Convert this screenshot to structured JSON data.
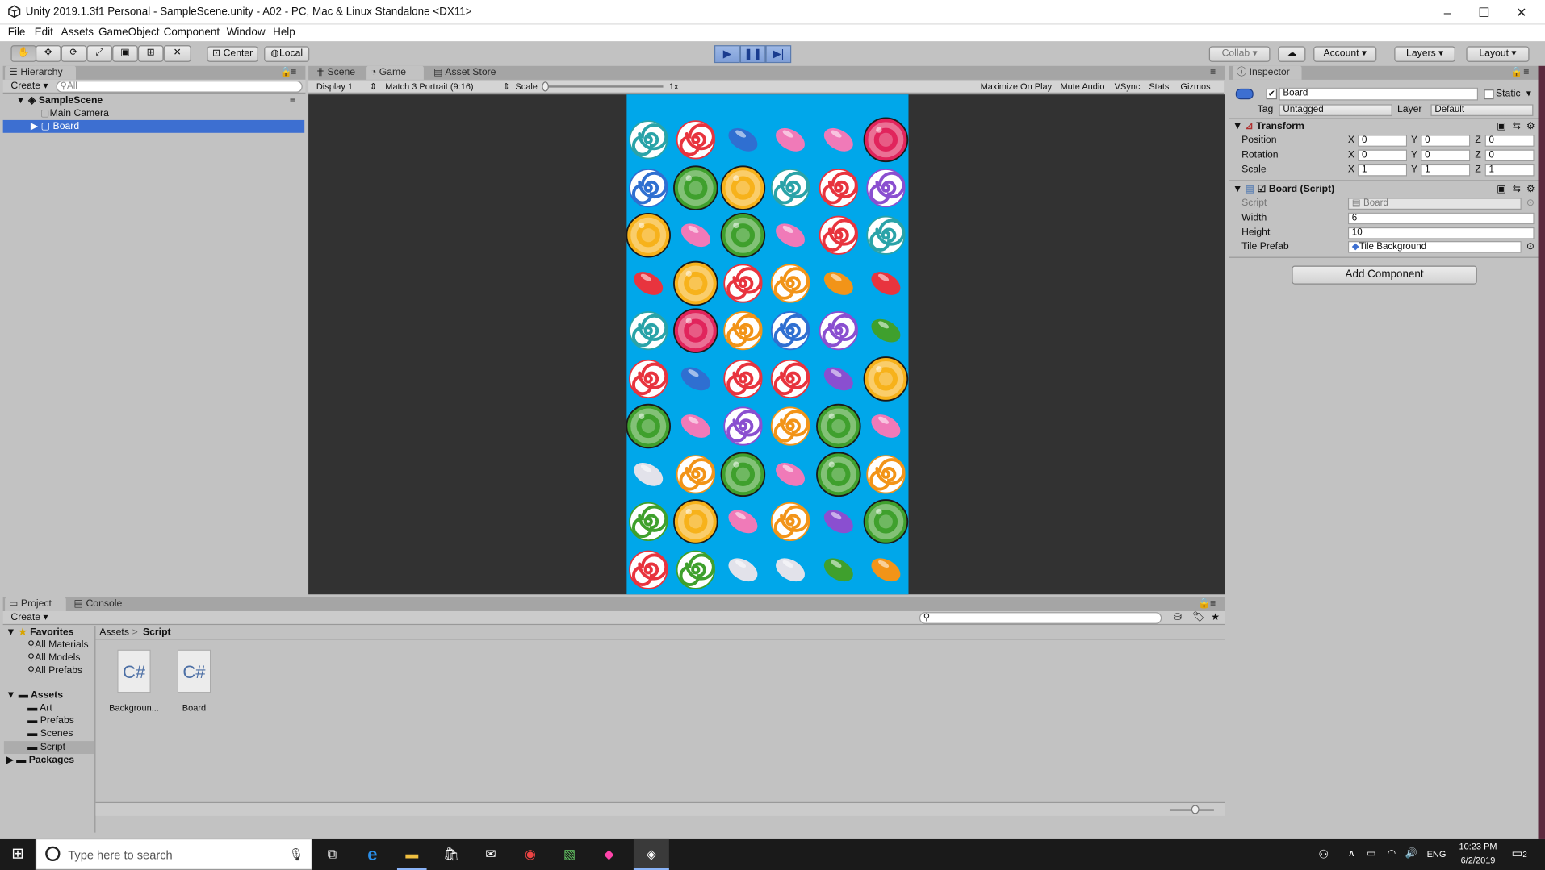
{
  "window": {
    "title": "Unity 2019.1.3f1 Personal - SampleScene.unity - A02 - PC, Mac & Linux Standalone <DX11>",
    "min_glyph": "–",
    "max_glyph": "☐",
    "close_glyph": "✕"
  },
  "menu": [
    "File",
    "Edit",
    "Assets",
    "GameObject",
    "Component",
    "Window",
    "Help"
  ],
  "toolbar": {
    "center": "Center",
    "local": "Local",
    "collab": "Collab ▾",
    "account": "Account ▾",
    "layers": "Layers ▾",
    "layout": "Layout ▾"
  },
  "hierarchy": {
    "tab": "Hierarchy",
    "create": "Create ▾",
    "search_placeholder": "All",
    "scene": "SampleScene",
    "items": [
      "Main Camera",
      "Board"
    ]
  },
  "tabs": {
    "scene": "Scene",
    "game": "Game",
    "store": "Asset Store"
  },
  "gamebar": {
    "display": "Display 1",
    "aspect": "Match 3 Portrait (9:16)",
    "scale_label": "Scale",
    "scale_value": "1x",
    "maximize": "Maximize On Play",
    "mute": "Mute Audio",
    "vsync": "VSync",
    "stats": "Stats",
    "gizmos": "Gizmos"
  },
  "inspector": {
    "tab": "Inspector",
    "name": "Board",
    "static": "Static",
    "tag_label": "Tag",
    "tag_value": "Untagged",
    "layer_label": "Layer",
    "layer_value": "Default",
    "transform_title": "Transform",
    "position_label": "Position",
    "rotation_label": "Rotation",
    "scale_label": "Scale",
    "position": [
      "0",
      "0",
      "0"
    ],
    "rotation": [
      "0",
      "0",
      "0"
    ],
    "scale": [
      "1",
      "1",
      "1"
    ],
    "axis": [
      "X",
      "Y",
      "Z"
    ],
    "script_title": "Board (Script)",
    "script_label": "Script",
    "script_value": "Board",
    "width_label": "Width",
    "width_value": "6",
    "height_label": "Height",
    "height_value": "10",
    "tile_label": "Tile Prefab",
    "tile_value": "Tile Background",
    "add_component": "Add Component"
  },
  "project": {
    "tab_project": "Project",
    "tab_console": "Console",
    "create": "Create ▾",
    "favorites": "Favorites",
    "fav_items": [
      "All Materials",
      "All Models",
      "All Prefabs"
    ],
    "assets": "Assets",
    "asset_folders": [
      "Art",
      "Prefabs",
      "Scenes",
      "Script"
    ],
    "packages": "Packages",
    "breadcrumb_root": "Assets",
    "breadcrumb_sep": ">",
    "breadcrumb_current": "Script",
    "files": [
      {
        "icon": "C#",
        "label": "Backgroun..."
      },
      {
        "icon": "C#",
        "label": "Board"
      }
    ]
  },
  "taskbar": {
    "search_placeholder": "Type here to search",
    "lang": "ENG",
    "time": "10:23 PM",
    "date": "6/2/2019",
    "notif": "2"
  },
  "board_grid": [
    [
      "swirl-teal",
      "swirl-red",
      "bean-blue",
      "bean-pink",
      "bean-pink",
      "ball-magenta"
    ],
    [
      "swirl-blue",
      "ball-green",
      "ball-yellow",
      "swirl-teal",
      "swirl-red",
      "swirl-purple"
    ],
    [
      "ball-yellow",
      "bean-pink",
      "ball-green",
      "bean-pink",
      "swirl-red",
      "swirl-teal"
    ],
    [
      "bean-red",
      "ball-yellow",
      "swirl-red",
      "swirl-orange",
      "bean-orange",
      "bean-red"
    ],
    [
      "swirl-teal",
      "ball-magenta",
      "swirl-orange",
      "swirl-blue",
      "swirl-purple",
      "bean-green"
    ],
    [
      "swirl-red",
      "bean-blue",
      "swirl-red",
      "swirl-red",
      "bean-purple",
      "ball-yellow"
    ],
    [
      "ball-green",
      "bean-pink",
      "swirl-purple",
      "swirl-orange",
      "ball-green",
      "bean-pink"
    ],
    [
      "bean-white",
      "swirl-orange",
      "ball-green",
      "bean-pink",
      "ball-green",
      "swirl-orange"
    ],
    [
      "swirl-green",
      "ball-yellow",
      "bean-pink",
      "swirl-orange",
      "bean-purple",
      "ball-green"
    ],
    [
      "swirl-red",
      "swirl-green",
      "bean-white",
      "bean-white",
      "bean-green",
      "bean-orange"
    ]
  ],
  "colors": {
    "red": "#e8343e",
    "teal": "#2aa3a8",
    "blue": "#2f6fd1",
    "purple": "#8a4fd0",
    "orange": "#f29418",
    "green": "#3fa02d",
    "pink": "#f07ab8",
    "magenta": "#e1245c",
    "yellow": "#f7b21b",
    "white": "#e2e2ea",
    "board_bg": "#00a7ea",
    "selection": "#3d6fd1"
  }
}
